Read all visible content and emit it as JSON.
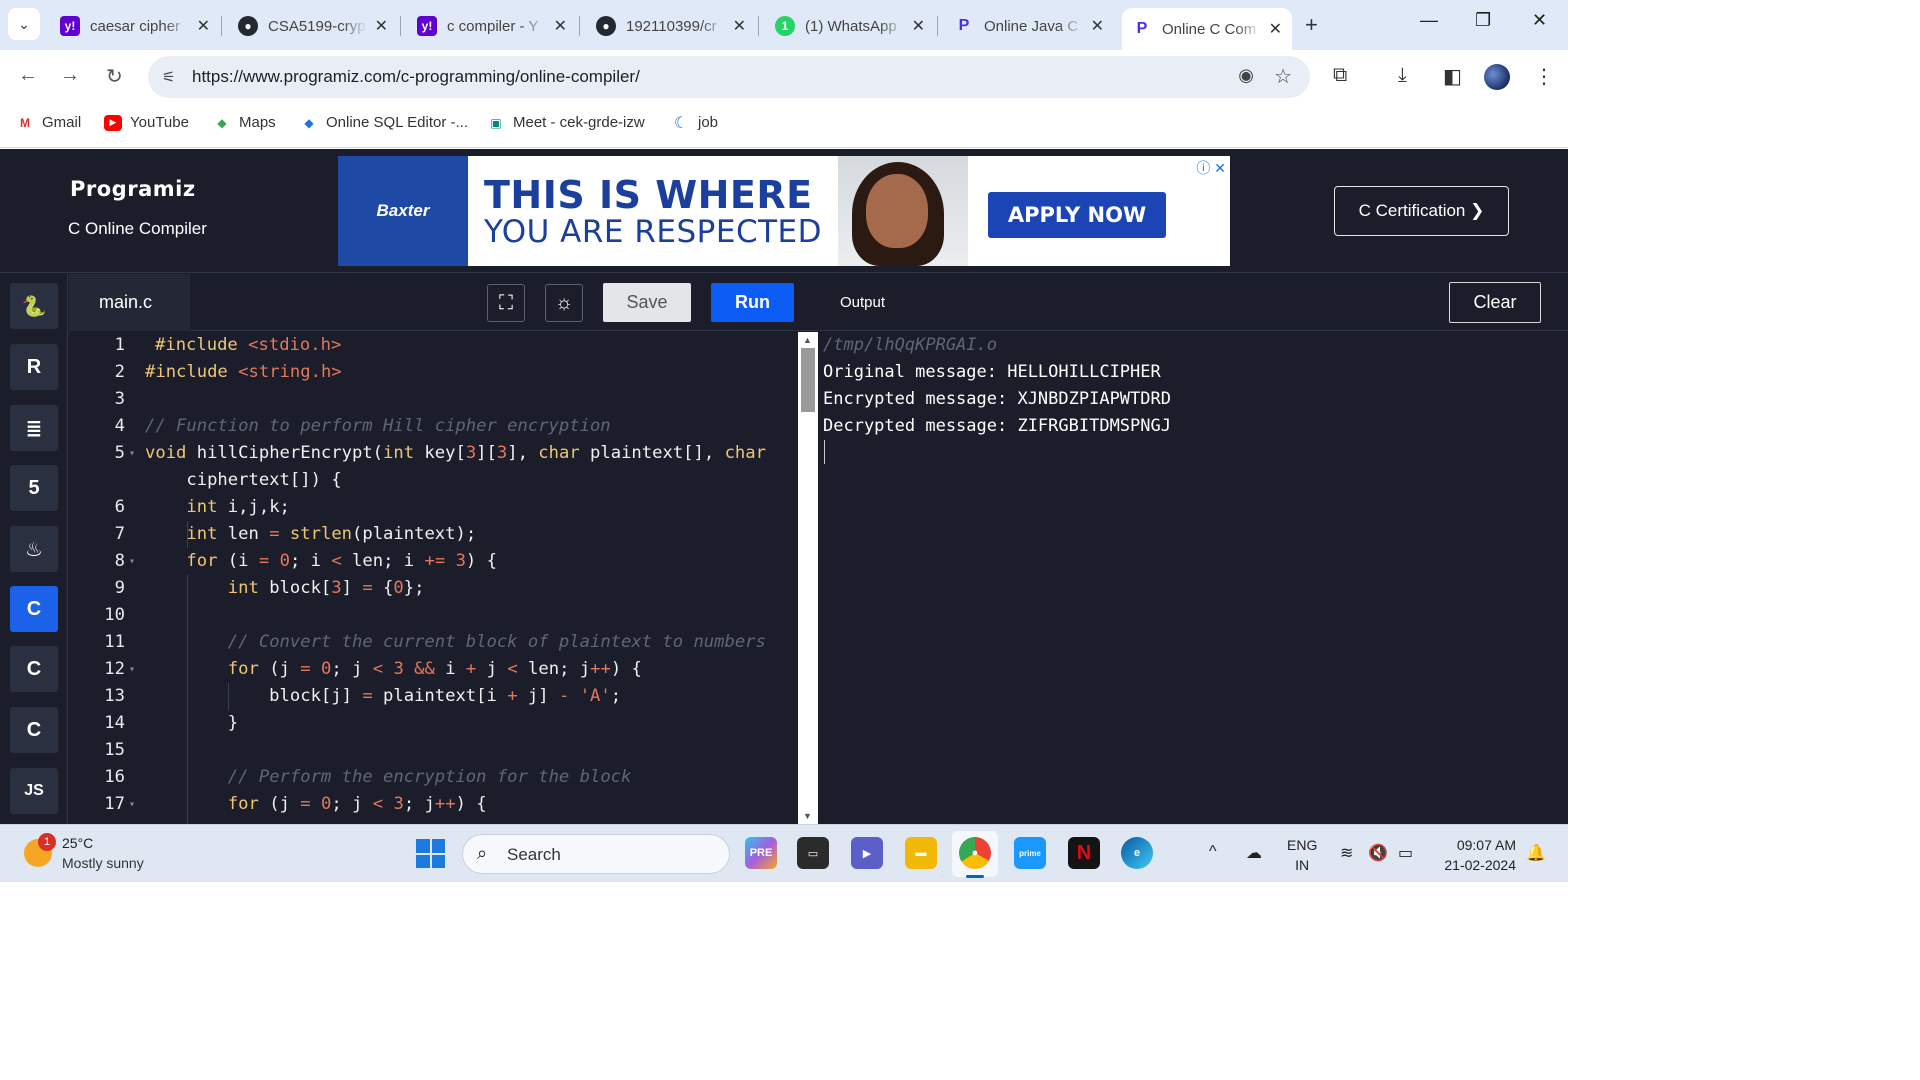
{
  "browser": {
    "tabs": [
      {
        "title": "caesar cipher",
        "favicon": "yahoo-icon",
        "color": "#6001d2"
      },
      {
        "title": "CSA5199-cryp",
        "favicon": "github-icon",
        "color": "#24292f"
      },
      {
        "title": "c compiler - Y",
        "favicon": "yahoo-icon",
        "color": "#6001d2"
      },
      {
        "title": "192110399/cr",
        "favicon": "github-icon",
        "color": "#24292f"
      },
      {
        "title": "(1) WhatsApp",
        "favicon": "whatsapp-icon",
        "color": "#25d366"
      },
      {
        "title": "Online Java C",
        "favicon": "programiz-icon",
        "color": "#4a2ee6"
      },
      {
        "title": "Online C Com",
        "favicon": "programiz-icon",
        "color": "#4a2ee6"
      }
    ],
    "url": "https://www.programiz.com/c-programming/online-compiler/",
    "bookmarks": [
      {
        "label": "Gmail",
        "icon": "gmail-icon"
      },
      {
        "label": "YouTube",
        "icon": "youtube-icon"
      },
      {
        "label": "Maps",
        "icon": "maps-icon"
      },
      {
        "label": "Online SQL Editor -...",
        "icon": "sql-icon"
      },
      {
        "label": "Meet - cek-grde-izw",
        "icon": "meet-icon"
      },
      {
        "label": "job",
        "icon": "job-icon"
      }
    ]
  },
  "site": {
    "logo": "Programiz",
    "subtitle": "C Online Compiler",
    "ad": {
      "brand": "Baxter",
      "line1": "THIS IS WHERE",
      "line2": "YOU ARE RESPECTED",
      "cta": "APPLY NOW"
    },
    "certification_button": "C Certification ❯",
    "languages": [
      {
        "name": "python-icon",
        "glyph": "🐍"
      },
      {
        "name": "r-icon",
        "glyph": "R"
      },
      {
        "name": "sql-icon",
        "glyph": "≣"
      },
      {
        "name": "html-icon",
        "glyph": "5"
      },
      {
        "name": "java-icon",
        "glyph": "♨"
      },
      {
        "name": "c-icon",
        "glyph": "C"
      },
      {
        "name": "cpp-icon",
        "glyph": "C"
      },
      {
        "name": "csharp-icon",
        "glyph": "C"
      },
      {
        "name": "js-icon",
        "glyph": "JS"
      }
    ]
  },
  "editor": {
    "filename": "main.c",
    "save_label": "Save",
    "run_label": "Run",
    "line_numbers": [
      "1",
      "2",
      "3",
      "4",
      "5",
      "",
      "6",
      "7",
      "8",
      "9",
      "10",
      "11",
      "12",
      "13",
      "14",
      "15",
      "16",
      "17"
    ]
  },
  "output": {
    "title": "Output",
    "clear_label": "Clear",
    "lines": [
      "/tmp/lhQqKPRGAI.o",
      "Original message: HELLOHILLCIPHER",
      "Encrypted message: XJNBDZPIAPWTDRD",
      "Decrypted message: ZIFRGBITDMSPNGJ"
    ]
  },
  "taskbar": {
    "temperature": "25°C",
    "weather": "Mostly sunny",
    "weather_badge": "1",
    "search_placeholder": "Search",
    "lang_line1": "ENG",
    "lang_line2": "IN",
    "time": "09:07 AM",
    "date": "21-02-2024"
  }
}
